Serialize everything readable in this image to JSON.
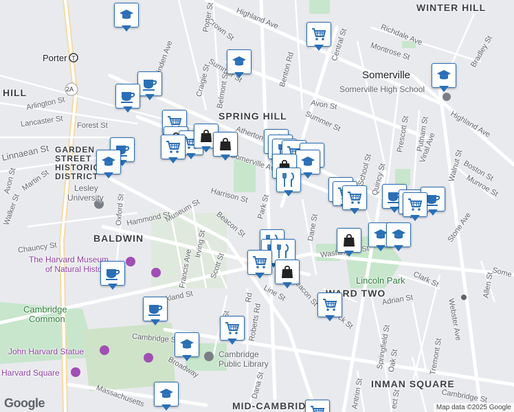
{
  "map": {
    "neighborhoods": {
      "winter_hill": "WINTER HILL",
      "spring_hill": "SPRING HILL",
      "baldwin": "BALDWIN",
      "ward_two": "WARD TWO",
      "inman_square": "INMAN SQUARE",
      "mid_cambridge": "MID-CAMBRIDGE",
      "harvard_square_area": "HARVARD SQUARE",
      "garden_street": "GARDEN STREET HISTORIC DISTRICT",
      "hill": "HILL",
      "porter": "Porter"
    },
    "places": {
      "somerville": "Somerville",
      "somerville_high": "Somerville High School",
      "lesley_1": "Lesley",
      "lesley_2": "University",
      "harvard_museum_1": "The Harvard Museum",
      "harvard_museum_2": "of Natural History",
      "lincoln_park": "Lincoln Park",
      "cambridge_common_1": "Cambridge",
      "cambridge_common_2": "Common",
      "john_harvard": "John Harvard Statue",
      "harvard_square": "Harvard Square",
      "cambridge_library_1": "Cambridge",
      "cambridge_library_2": "Public Library"
    },
    "streets": {
      "highland_ave_top": "Highland Ave",
      "crown_st": "Crown St",
      "porter_st": "Porter St",
      "central_st": "Central St",
      "richdale": "Richdale Ave",
      "montrose": "Montrose St",
      "bradley": "Bradley St",
      "linden": "Linden Ave",
      "summer_st_top": "Summer St",
      "craigie": "Craigie St",
      "belmont": "Belmont St",
      "benton": "Benton Rd",
      "avon_st": "Avon St",
      "summer_st_mid": "Summer St",
      "highland_ave_right": "Highland Ave",
      "arlington": "Arlington St",
      "lancaster": "Lancaster St",
      "forest": "Forest St",
      "linnaean": "Linnaean St",
      "avon_st_left": "Avon St",
      "martin": "Martin St",
      "atherton": "Atherton St",
      "somerville_ave": "Somerville Ave",
      "prescott": "Prescott St",
      "putnam": "Putnam St",
      "vinal": "Vinal Ave",
      "school": "School St",
      "quincy": "Quincy St",
      "walnut": "Walnut St",
      "boston": "Boston St",
      "munroe": "Munroe St",
      "walker": "Walker St",
      "hammond": "Hammond St",
      "museum": "Museum St",
      "harrison": "Harrison St",
      "park": "Park St",
      "beacon_st": "Beacon St",
      "dane": "Dane St",
      "stone": "Stone Ave",
      "chauncy": "Chauncy St",
      "oxford": "Oxford St",
      "irving": "Irving St",
      "francis": "Francis Ave",
      "scott": "Scott St",
      "washington": "Washington St",
      "some": "Some",
      "clark": "Clark St",
      "allen": "Allen St",
      "kirkland": "Kirkland St",
      "line": "Line St",
      "beacon_st2": "Beacon St",
      "adrian": "Adrian St",
      "webster": "Webster Ave",
      "cambridge_st": "Cambridge St",
      "broadway": "Broadway",
      "springfield": "Springfield St",
      "oak": "Oak St",
      "tremont": "Tremont St",
      "massachusetts": "Massachusetts",
      "dana": "Dana St",
      "roberts": "Roberts Rd",
      "antrim": "Antrim St",
      "cambridge_st2": "Cambridge St",
      "rd_label": "Rd",
      "ge_st": "ge St",
      "ck_st": "ck St",
      "est_st": "ect St"
    },
    "footer": "Map data ©2025 Google",
    "logo": "Google",
    "route_badge": "2A",
    "colors": {
      "background": "#e9eaee",
      "park": "#c7e6cc",
      "road": "#ffffff",
      "marker_border": "#2a6fb6",
      "icon": "#2a6fb6"
    }
  }
}
